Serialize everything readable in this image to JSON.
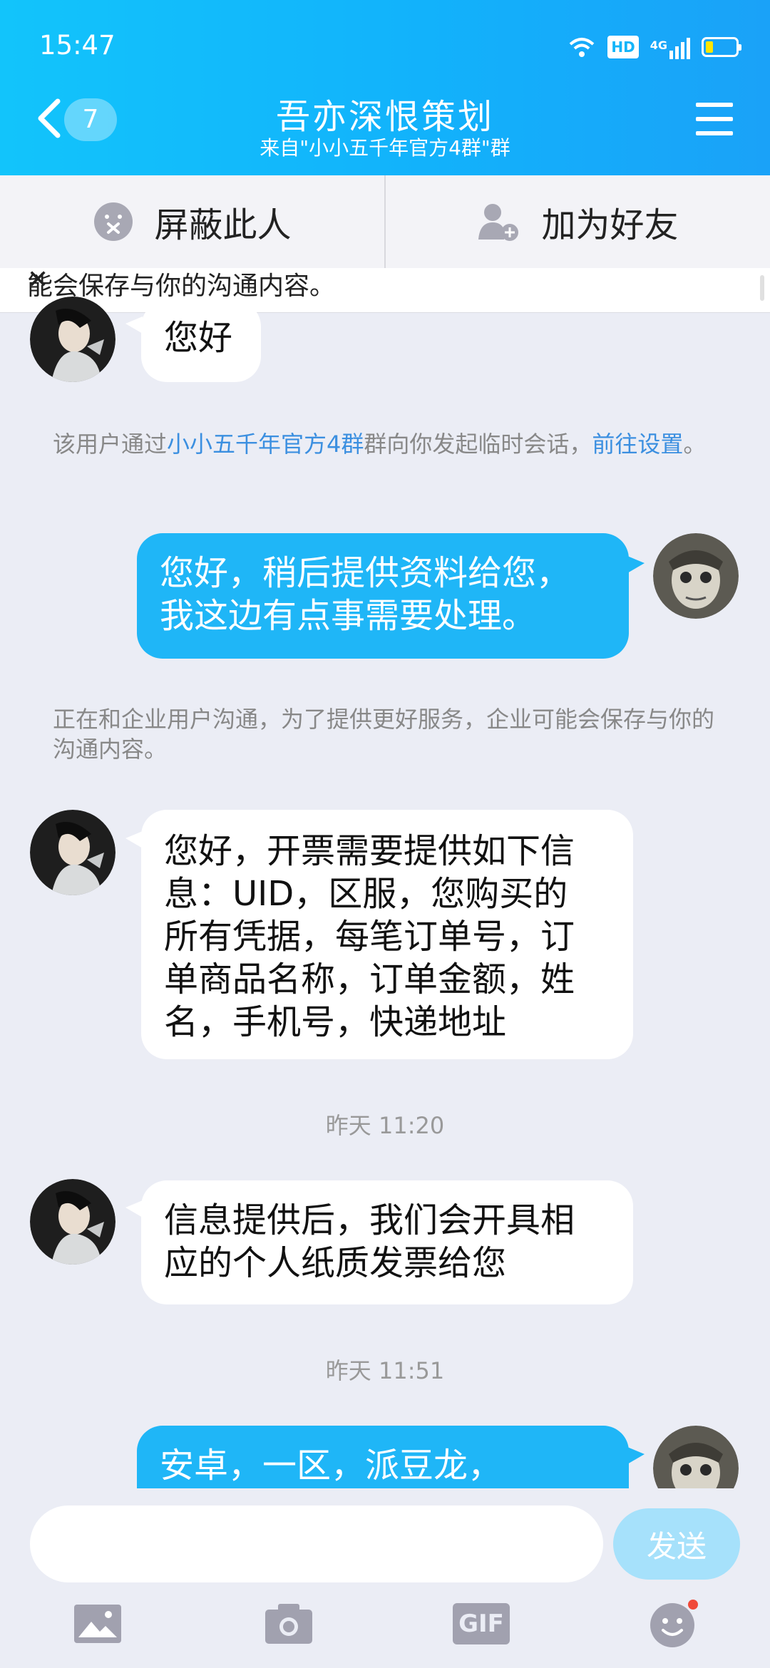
{
  "status_bar": {
    "time": "15:47",
    "network_badge": "HD",
    "signal_label": "4G"
  },
  "header": {
    "unread_count": "7",
    "title": "吾亦深恨策划",
    "subtitle": "来自\"小小五千年官方4群\"群"
  },
  "actions": {
    "block_label": "屏蔽此人",
    "add_friend_label": "加为好友"
  },
  "notice": {
    "text": "能会保存与你的沟通内容。"
  },
  "messages": [
    {
      "type": "in",
      "text": "您好"
    },
    {
      "type": "system",
      "prefix": "该用户通过",
      "group": "小小五千年官方4群",
      "middle": "群向你发起临时会话，",
      "link": "前往设置",
      "suffix": "。"
    },
    {
      "type": "out",
      "text": "您好，稍后提供资料给您，\n我这边有点事需要处理。"
    },
    {
      "type": "system",
      "text": "正在和企业用户沟通，为了提供更好服务，企业可能会保存与你的沟通内容。"
    },
    {
      "type": "in",
      "text": "您好，开票需要提供如下信\n息：UID，区服，您购买的\n所有凭据，每笔订单号，订\n单商品名称，订单金额，姓\n名，手机号，快递地址"
    },
    {
      "type": "timestamp",
      "text": "昨天 11:20"
    },
    {
      "type": "in",
      "text": "信息提供后，我们会开具相\n应的个人纸质发票给您"
    },
    {
      "type": "timestamp",
      "text": "昨天 11:51"
    },
    {
      "type": "out",
      "text": "安卓，一区，派豆龙，"
    }
  ],
  "composer": {
    "input_value": "",
    "send_label": "发送"
  },
  "toolbar": {
    "gif_label": "GIF"
  },
  "colors": {
    "header": "#12b2fb",
    "bubble_out": "#1fb6f7",
    "link": "#3b8fe0",
    "badge_dot": "#f04a3a"
  }
}
